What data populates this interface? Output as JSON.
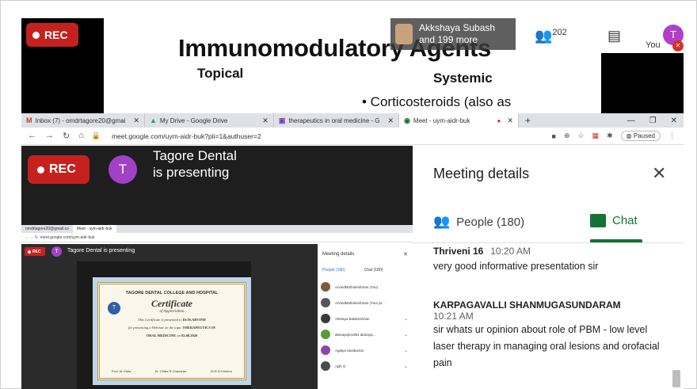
{
  "slide": {
    "rec_label": "REC",
    "title": "Immunomodulatory Agents",
    "topical": "Topical",
    "systemic": "Systemic",
    "bullet": "•  Corticosteroids (also as",
    "presenter_line1": "Akkshaya Subash",
    "presenter_line2": "and 199 more",
    "people_count": "202",
    "you_label": "You",
    "avatar_initial": "T"
  },
  "browser": {
    "tabs": [
      {
        "icon": "M",
        "label": "Inbox (7) - omdrtagore20@gmai"
      },
      {
        "icon": "▲",
        "label": "My Drive - Google Drive"
      },
      {
        "icon": "▣",
        "label": "therapeutics in oral medicine - G"
      },
      {
        "icon": "◉",
        "label": "Meet - uym-aidr-buk"
      }
    ],
    "url": "meet.google.com/uym-aidr-buk?pli=1&authuser=2",
    "paused_label": "Paused"
  },
  "meet": {
    "rec_label": "REC",
    "avatar_initial": "T",
    "presenting_text": "Tagore Dental is presenting"
  },
  "nested": {
    "tabs": [
      "omdrtagore20@gmail.co",
      "Meet - uym-aidr-buk"
    ],
    "url": "meet.google.com/uym-aidr-buk",
    "rec_label": "REC",
    "avatar_initial": "T",
    "presenting_text": "Tagore Dental is presenting",
    "cert_header": "TAGORE DENTAL COLLEGE AND HOSPITAL",
    "cert_title": "Certificate",
    "cert_sub": "of Appreciation",
    "cert_line1": "This Certificate is presented to",
    "cert_name": "Dr.M.ARVIND",
    "cert_line2": "for presenting a Webinar on the topic",
    "cert_topic": "THERAPEUTICS IN",
    "cert_topic2": "ORAL MEDICINE",
    "cert_on": "on",
    "cert_date": "02.08.2020",
    "cert_sig1": "Prof. M. Mala",
    "cert_sig2": "Dr. Chitra R Chandran",
    "cert_sig3": "Dr.R.G.Krishna",
    "side_title": "Meeting details",
    "side_people": "People (180)",
    "side_chat": "Chat (180)",
    "participants": [
      {
        "name": "ArvindMuthukrishnan (You)",
        "color": "#7a5c3c"
      },
      {
        "name": "ArvindMuthukrishnan (Your pr...",
        "color": "#555555"
      },
      {
        "name": "Abinaya Balakrishnan",
        "color": "#3a3a3a"
      },
      {
        "name": "abinayajm1981 abinaya...",
        "color": "#5b9b3a"
      },
      {
        "name": "Agalya Sivakumar",
        "color": "#8e44ad"
      },
      {
        "name": "Ajith G",
        "color": "#4a4a4a"
      }
    ]
  },
  "panel": {
    "title": "Meeting details",
    "people_label": "People (180)",
    "chat_label": "Chat",
    "messages": [
      {
        "sender": "Thriveni 16",
        "time": "10:20 AM",
        "text": "very good informative presentation  sir"
      },
      {
        "sender": "KARPAGAVALLI SHANMUGASUNDARAM",
        "time": "10:21 AM",
        "text": "sir whats ur opinion about role of PBM - low level laser therapy in managing oral lesions and orofacial pain"
      }
    ]
  }
}
